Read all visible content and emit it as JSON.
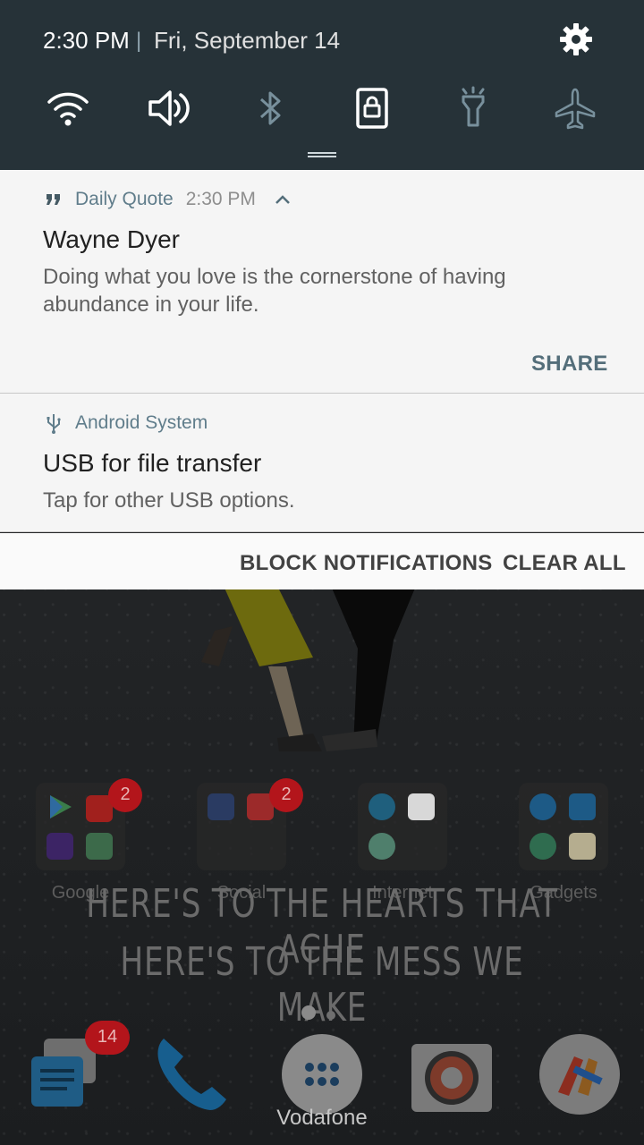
{
  "status": {
    "time": "2:30 PM",
    "separator": "|",
    "date": "Fri, September 14"
  },
  "quick_settings": [
    {
      "icon": "wifi-icon",
      "active": true
    },
    {
      "icon": "volume-icon",
      "active": true
    },
    {
      "icon": "bluetooth-icon",
      "active": false
    },
    {
      "icon": "screen-lock-icon",
      "active": true
    },
    {
      "icon": "flashlight-icon",
      "active": false
    },
    {
      "icon": "airplane-icon",
      "active": false
    }
  ],
  "notifications": [
    {
      "app": "Daily Quote",
      "time": "2:30 PM",
      "title": "Wayne Dyer",
      "text": "Doing what you love is the cornerstone of having abundance in your life.",
      "action": "SHARE"
    },
    {
      "app": "Android System",
      "title": "USB for file transfer",
      "text": "Tap for other USB options."
    }
  ],
  "footer_actions": {
    "block": "BLOCK NOTIFICATIONS",
    "clear": "CLEAR ALL"
  },
  "home": {
    "folders": [
      {
        "label": "Google",
        "badge": "2"
      },
      {
        "label": "Social",
        "badge": "2"
      },
      {
        "label": "Internet"
      },
      {
        "label": "Gadgets"
      }
    ],
    "wallpaper_text": [
      "HERE'S TO THE HEARTS THAT ACHE",
      "HERE'S TO THE MESS WE MAKE"
    ],
    "dock": {
      "messages_badge": "14",
      "label": "Vodafone"
    }
  },
  "colors": {
    "shade": "#263238",
    "notification_bg": "#f5f5f5",
    "accent": "#546e7a",
    "badge": "#b3151b"
  }
}
